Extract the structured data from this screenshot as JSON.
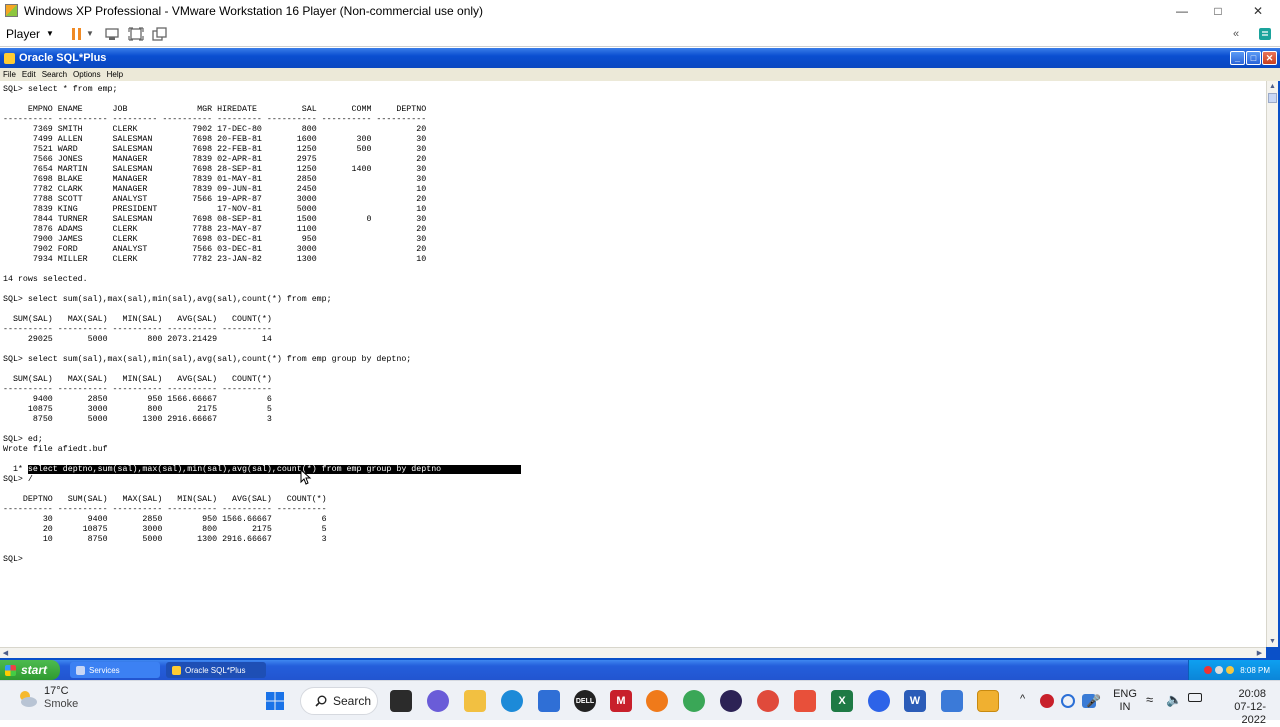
{
  "host_window": {
    "title": "Windows XP Professional - VMware Workstation 16 Player (Non-commercial use only)",
    "toolbar": {
      "player_label": "Player"
    }
  },
  "guest_window": {
    "title": "Oracle SQL*Plus",
    "menu": [
      "File",
      "Edit",
      "Search",
      "Options",
      "Help"
    ]
  },
  "console": {
    "lines": [
      "SQL> select * from emp;",
      "",
      "     EMPNO ENAME      JOB              MGR HIREDATE         SAL       COMM     DEPTNO",
      "---------- ---------- --------- ---------- --------- ---------- ---------- ----------",
      "      7369 SMITH      CLERK           7902 17-DEC-80        800                    20",
      "      7499 ALLEN      SALESMAN        7698 20-FEB-81       1600        300         30",
      "      7521 WARD       SALESMAN        7698 22-FEB-81       1250        500         30",
      "      7566 JONES      MANAGER         7839 02-APR-81       2975                    20",
      "      7654 MARTIN     SALESMAN        7698 28-SEP-81       1250       1400         30",
      "      7698 BLAKE      MANAGER         7839 01-MAY-81       2850                    30",
      "      7782 CLARK      MANAGER         7839 09-JUN-81       2450                    10",
      "      7788 SCOTT      ANALYST         7566 19-APR-87       3000                    20",
      "      7839 KING       PRESIDENT            17-NOV-81       5000                    10",
      "      7844 TURNER     SALESMAN        7698 08-SEP-81       1500          0         30",
      "      7876 ADAMS      CLERK           7788 23-MAY-87       1100                    20",
      "      7900 JAMES      CLERK           7698 03-DEC-81        950                    30",
      "      7902 FORD       ANALYST         7566 03-DEC-81       3000                    20",
      "      7934 MILLER     CLERK           7782 23-JAN-82       1300                    10",
      "",
      "14 rows selected.",
      "",
      "SQL> select sum(sal),max(sal),min(sal),avg(sal),count(*) from emp;",
      "",
      "  SUM(SAL)   MAX(SAL)   MIN(SAL)   AVG(SAL)   COUNT(*)",
      "---------- ---------- ---------- ---------- ----------",
      "     29025       5000        800 2073.21429         14",
      "",
      "SQL> select sum(sal),max(sal),min(sal),avg(sal),count(*) from emp group by deptno;",
      "",
      "  SUM(SAL)   MAX(SAL)   MIN(SAL)   AVG(SAL)   COUNT(*)",
      "---------- ---------- ---------- ---------- ----------",
      "      9400       2850        950 1566.66667          6",
      "     10875       3000        800       2175          5",
      "      8750       5000       1300 2916.66667          3",
      "",
      "SQL> ed;",
      "Wrote file afiedt.buf",
      ""
    ],
    "edit_prefix": "  1* ",
    "edited_query": "select deptno,sum(sal),max(sal),min(sal),avg(sal),count(*) from emp group by deptno                ",
    "lines_after": [
      "SQL> /",
      "",
      "    DEPTNO   SUM(SAL)   MAX(SAL)   MIN(SAL)   AVG(SAL)   COUNT(*)",
      "---------- ---------- ---------- ---------- ---------- ----------",
      "        30       9400       2850        950 1566.66667          6",
      "        20      10875       3000        800       2175          5",
      "        10       8750       5000       1300 2916.66667          3",
      "",
      "SQL>"
    ]
  },
  "xp_taskbar": {
    "start_label": "start",
    "tasks": [
      "Services",
      "Oracle SQL*Plus"
    ],
    "clock": "8:08 PM"
  },
  "win_taskbar": {
    "weather_temp": "17°C",
    "weather_desc": "Smoke",
    "search_label": "Search",
    "lang_line1": "ENG",
    "lang_line2": "IN",
    "time": "20:08",
    "date": "07-12-2022"
  },
  "colors": {
    "xp_title_blue": "#0a4ed0",
    "xp_start_green": "#2f9a30",
    "console_bg": "#ffffff",
    "highlight_bg": "#000000"
  }
}
